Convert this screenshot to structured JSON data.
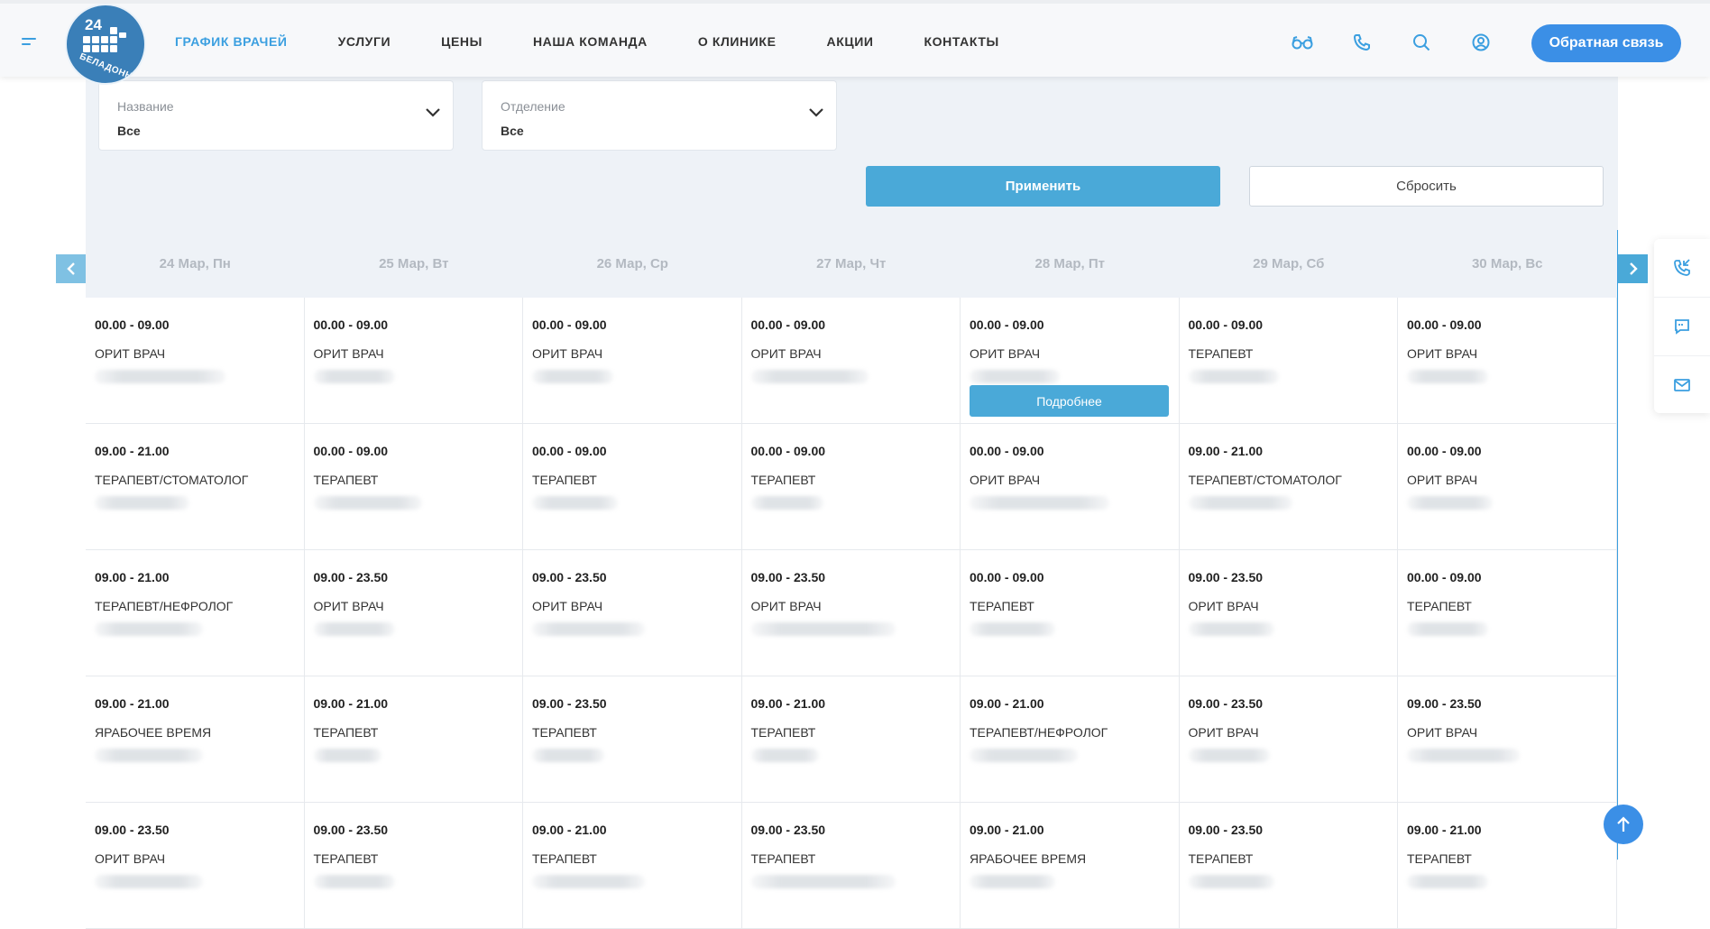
{
  "header": {
    "logo": {
      "number": "24",
      "text": "БЕЛАДОННА"
    },
    "nav": [
      {
        "label": "ГРАФИК ВРАЧЕЙ",
        "active": true
      },
      {
        "label": "УСЛУГИ"
      },
      {
        "label": "ЦЕНЫ"
      },
      {
        "label": "НАША КОМАНДА"
      },
      {
        "label": "О КЛИНИКЕ"
      },
      {
        "label": "АКЦИИ"
      },
      {
        "label": "КОНТАКТЫ"
      }
    ],
    "icons": [
      "glasses-icon",
      "phone-icon",
      "search-icon",
      "user-icon"
    ],
    "feedback_label": "Обратная связь"
  },
  "filter": {
    "name": {
      "label": "Название",
      "value": "Все"
    },
    "department": {
      "label": "Отделение",
      "value": "Все"
    },
    "apply_label": "Применить",
    "reset_label": "Сбросить"
  },
  "schedule": {
    "days": [
      {
        "num": "24",
        "label": "Мар, Пн"
      },
      {
        "num": "25",
        "label": "Мар, Вт"
      },
      {
        "num": "26",
        "label": "Мар, Ср"
      },
      {
        "num": "27",
        "label": "Мар, Чт"
      },
      {
        "num": "28",
        "label": "Мар, Пт"
      },
      {
        "num": "29",
        "label": "Мар, Сб"
      },
      {
        "num": "30",
        "label": "Мар, Вс"
      }
    ],
    "more_label": "Подробнее",
    "rows": [
      [
        {
          "time": "00.00 - 09.00",
          "role": "ОРИТ ВРАЧ"
        },
        {
          "time": "00.00 - 09.00",
          "role": "ОРИТ ВРАЧ"
        },
        {
          "time": "00.00 - 09.00",
          "role": "ОРИТ ВРАЧ"
        },
        {
          "time": "00.00 - 09.00",
          "role": "ОРИТ ВРАЧ"
        },
        {
          "time": "00.00 - 09.00",
          "role": "ОРИТ ВРАЧ",
          "more": true
        },
        {
          "time": "00.00 - 09.00",
          "role": "ТЕРАПЕВТ"
        },
        {
          "time": "00.00 - 09.00",
          "role": "ОРИТ ВРАЧ"
        }
      ],
      [
        {
          "time": "09.00 - 21.00",
          "role": "ТЕРАПЕВТ/СТОМАТОЛОГ"
        },
        {
          "time": "00.00 - 09.00",
          "role": "ТЕРАПЕВТ"
        },
        {
          "time": "00.00 - 09.00",
          "role": "ТЕРАПЕВТ"
        },
        {
          "time": "00.00 - 09.00",
          "role": "ТЕРАПЕВТ"
        },
        {
          "time": "00.00 - 09.00",
          "role": "ОРИТ ВРАЧ"
        },
        {
          "time": "09.00 - 21.00",
          "role": "ТЕРАПЕВТ/СТОМАТОЛОГ"
        },
        {
          "time": "00.00 - 09.00",
          "role": "ОРИТ ВРАЧ"
        }
      ],
      [
        {
          "time": "09.00 - 21.00",
          "role": "ТЕРАПЕВТ/НЕФРОЛОГ"
        },
        {
          "time": "09.00 - 23.50",
          "role": "ОРИТ ВРАЧ"
        },
        {
          "time": "09.00 - 23.50",
          "role": "ОРИТ ВРАЧ"
        },
        {
          "time": "09.00 - 23.50",
          "role": "ОРИТ ВРАЧ"
        },
        {
          "time": "00.00 - 09.00",
          "role": "ТЕРАПЕВТ"
        },
        {
          "time": "09.00 - 23.50",
          "role": "ОРИТ ВРАЧ"
        },
        {
          "time": "00.00 - 09.00",
          "role": "ТЕРАПЕВТ"
        }
      ],
      [
        {
          "time": "09.00 - 21.00",
          "role": "ЯРАБОЧЕЕ ВРЕМЯ"
        },
        {
          "time": "09.00 - 21.00",
          "role": "ТЕРАПЕВТ"
        },
        {
          "time": "09.00 - 23.50",
          "role": "ТЕРАПЕВТ"
        },
        {
          "time": "09.00 - 21.00",
          "role": "ТЕРАПЕВТ"
        },
        {
          "time": "09.00 - 21.00",
          "role": "ТЕРАПЕВТ/НЕФРОЛОГ"
        },
        {
          "time": "09.00 - 23.50",
          "role": "ОРИТ ВРАЧ"
        },
        {
          "time": "09.00 - 23.50",
          "role": "ОРИТ ВРАЧ"
        }
      ],
      [
        {
          "time": "09.00 - 23.50",
          "role": "ОРИТ ВРАЧ"
        },
        {
          "time": "09.00 - 23.50",
          "role": "ТЕРАПЕВТ"
        },
        {
          "time": "09.00 - 21.00",
          "role": "ТЕРАПЕВТ"
        },
        {
          "time": "09.00 - 23.50",
          "role": "ТЕРАПЕВТ"
        },
        {
          "time": "09.00 - 21.00",
          "role": "ЯРАБОЧЕЕ ВРЕМЯ"
        },
        {
          "time": "09.00 - 23.50",
          "role": "ТЕРАПЕВТ"
        },
        {
          "time": "09.00 - 21.00",
          "role": "ТЕРАПЕВТ"
        }
      ]
    ]
  },
  "side_widget": [
    "phone-callback-icon",
    "chat-icon",
    "mail-icon"
  ],
  "colors": {
    "accent": "#3b9fe0",
    "button": "#4aa9d8",
    "panel": "#eef2f7"
  }
}
